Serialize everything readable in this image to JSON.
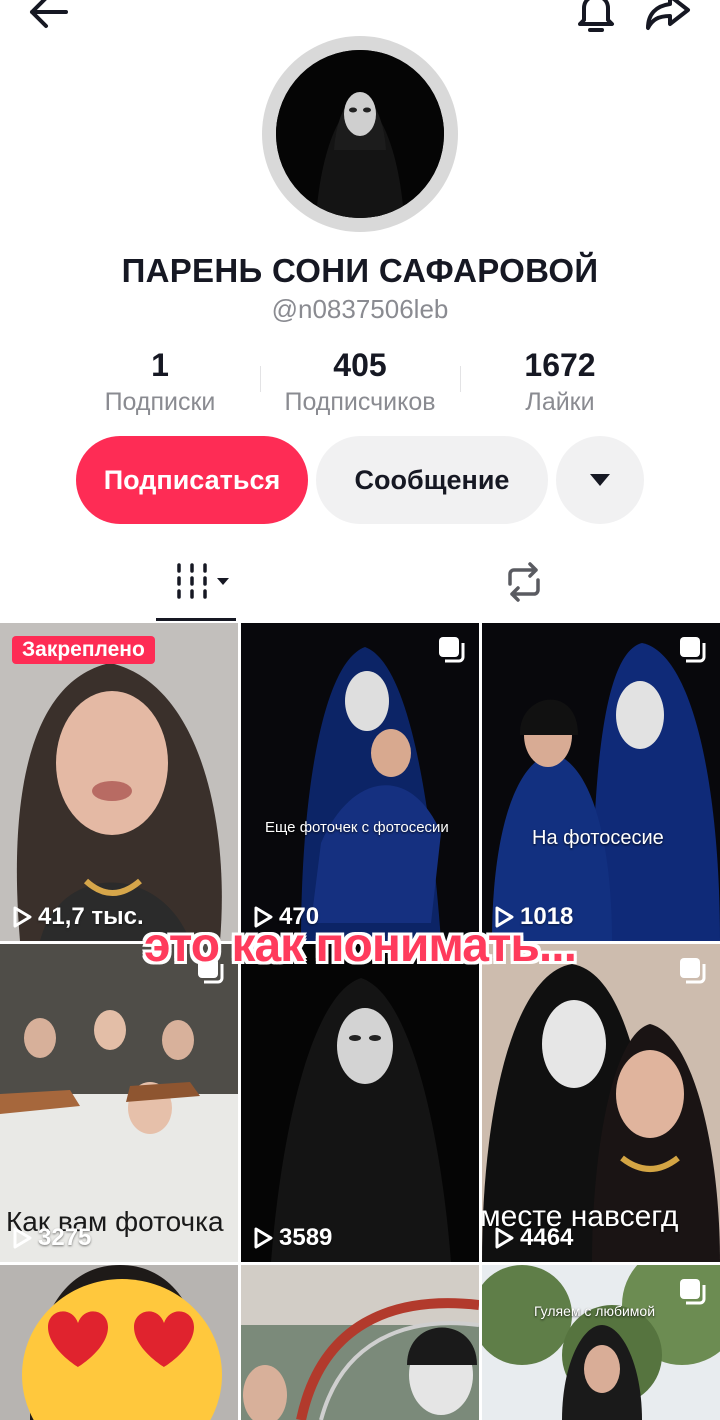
{
  "profile": {
    "name": "ПАРЕНЬ СОНИ САФАРОВОЙ",
    "handle": "@n0837506leb"
  },
  "stats": [
    {
      "value": "1",
      "label": "Подписки"
    },
    {
      "value": "405",
      "label": "Подписчиков"
    },
    {
      "value": "1672",
      "label": "Лайки"
    }
  ],
  "actions": {
    "follow": "Подписаться",
    "message": "Сообщение"
  },
  "videos": {
    "pinned_label": "Закреплено",
    "items": [
      {
        "views": "41,7 тыс.",
        "caption": ""
      },
      {
        "views": "470",
        "caption": "Еще фоточек с фотосесии"
      },
      {
        "views": "1018",
        "caption": "На фотосесие"
      },
      {
        "views": "3275",
        "caption": "Как вам фоточка"
      },
      {
        "views": "3589",
        "caption": ""
      },
      {
        "views": "4464",
        "caption": "месте навсегд"
      },
      {
        "views": "",
        "caption": ""
      },
      {
        "views": "",
        "caption": ""
      },
      {
        "views": "",
        "caption": "Гуляем с любимой"
      }
    ]
  },
  "overlay_text": "это как понимать...",
  "colors": {
    "accent": "#fe2c55",
    "text": "#161823",
    "secondary": "#8a8b91"
  },
  "icons": [
    "back-arrow-icon",
    "bell-icon",
    "share-icon",
    "caret-down-icon",
    "videos-grid-icon",
    "repost-icon",
    "play-icon",
    "multi-photo-icon"
  ]
}
